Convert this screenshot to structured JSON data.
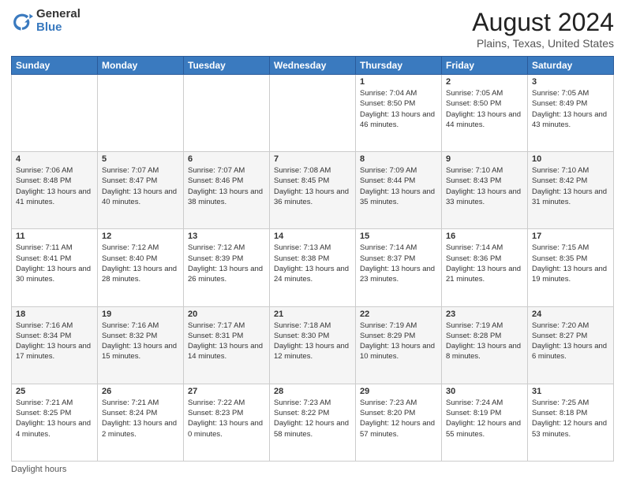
{
  "header": {
    "logo_general": "General",
    "logo_blue": "Blue",
    "title": "August 2024",
    "subtitle": "Plains, Texas, United States"
  },
  "days_of_week": [
    "Sunday",
    "Monday",
    "Tuesday",
    "Wednesday",
    "Thursday",
    "Friday",
    "Saturday"
  ],
  "weeks": [
    [
      {
        "day": "",
        "info": ""
      },
      {
        "day": "",
        "info": ""
      },
      {
        "day": "",
        "info": ""
      },
      {
        "day": "",
        "info": ""
      },
      {
        "day": "1",
        "info": "Sunrise: 7:04 AM\nSunset: 8:50 PM\nDaylight: 13 hours and 46 minutes."
      },
      {
        "day": "2",
        "info": "Sunrise: 7:05 AM\nSunset: 8:50 PM\nDaylight: 13 hours and 44 minutes."
      },
      {
        "day": "3",
        "info": "Sunrise: 7:05 AM\nSunset: 8:49 PM\nDaylight: 13 hours and 43 minutes."
      }
    ],
    [
      {
        "day": "4",
        "info": "Sunrise: 7:06 AM\nSunset: 8:48 PM\nDaylight: 13 hours and 41 minutes."
      },
      {
        "day": "5",
        "info": "Sunrise: 7:07 AM\nSunset: 8:47 PM\nDaylight: 13 hours and 40 minutes."
      },
      {
        "day": "6",
        "info": "Sunrise: 7:07 AM\nSunset: 8:46 PM\nDaylight: 13 hours and 38 minutes."
      },
      {
        "day": "7",
        "info": "Sunrise: 7:08 AM\nSunset: 8:45 PM\nDaylight: 13 hours and 36 minutes."
      },
      {
        "day": "8",
        "info": "Sunrise: 7:09 AM\nSunset: 8:44 PM\nDaylight: 13 hours and 35 minutes."
      },
      {
        "day": "9",
        "info": "Sunrise: 7:10 AM\nSunset: 8:43 PM\nDaylight: 13 hours and 33 minutes."
      },
      {
        "day": "10",
        "info": "Sunrise: 7:10 AM\nSunset: 8:42 PM\nDaylight: 13 hours and 31 minutes."
      }
    ],
    [
      {
        "day": "11",
        "info": "Sunrise: 7:11 AM\nSunset: 8:41 PM\nDaylight: 13 hours and 30 minutes."
      },
      {
        "day": "12",
        "info": "Sunrise: 7:12 AM\nSunset: 8:40 PM\nDaylight: 13 hours and 28 minutes."
      },
      {
        "day": "13",
        "info": "Sunrise: 7:12 AM\nSunset: 8:39 PM\nDaylight: 13 hours and 26 minutes."
      },
      {
        "day": "14",
        "info": "Sunrise: 7:13 AM\nSunset: 8:38 PM\nDaylight: 13 hours and 24 minutes."
      },
      {
        "day": "15",
        "info": "Sunrise: 7:14 AM\nSunset: 8:37 PM\nDaylight: 13 hours and 23 minutes."
      },
      {
        "day": "16",
        "info": "Sunrise: 7:14 AM\nSunset: 8:36 PM\nDaylight: 13 hours and 21 minutes."
      },
      {
        "day": "17",
        "info": "Sunrise: 7:15 AM\nSunset: 8:35 PM\nDaylight: 13 hours and 19 minutes."
      }
    ],
    [
      {
        "day": "18",
        "info": "Sunrise: 7:16 AM\nSunset: 8:34 PM\nDaylight: 13 hours and 17 minutes."
      },
      {
        "day": "19",
        "info": "Sunrise: 7:16 AM\nSunset: 8:32 PM\nDaylight: 13 hours and 15 minutes."
      },
      {
        "day": "20",
        "info": "Sunrise: 7:17 AM\nSunset: 8:31 PM\nDaylight: 13 hours and 14 minutes."
      },
      {
        "day": "21",
        "info": "Sunrise: 7:18 AM\nSunset: 8:30 PM\nDaylight: 13 hours and 12 minutes."
      },
      {
        "day": "22",
        "info": "Sunrise: 7:19 AM\nSunset: 8:29 PM\nDaylight: 13 hours and 10 minutes."
      },
      {
        "day": "23",
        "info": "Sunrise: 7:19 AM\nSunset: 8:28 PM\nDaylight: 13 hours and 8 minutes."
      },
      {
        "day": "24",
        "info": "Sunrise: 7:20 AM\nSunset: 8:27 PM\nDaylight: 13 hours and 6 minutes."
      }
    ],
    [
      {
        "day": "25",
        "info": "Sunrise: 7:21 AM\nSunset: 8:25 PM\nDaylight: 13 hours and 4 minutes."
      },
      {
        "day": "26",
        "info": "Sunrise: 7:21 AM\nSunset: 8:24 PM\nDaylight: 13 hours and 2 minutes."
      },
      {
        "day": "27",
        "info": "Sunrise: 7:22 AM\nSunset: 8:23 PM\nDaylight: 13 hours and 0 minutes."
      },
      {
        "day": "28",
        "info": "Sunrise: 7:23 AM\nSunset: 8:22 PM\nDaylight: 12 hours and 58 minutes."
      },
      {
        "day": "29",
        "info": "Sunrise: 7:23 AM\nSunset: 8:20 PM\nDaylight: 12 hours and 57 minutes."
      },
      {
        "day": "30",
        "info": "Sunrise: 7:24 AM\nSunset: 8:19 PM\nDaylight: 12 hours and 55 minutes."
      },
      {
        "day": "31",
        "info": "Sunrise: 7:25 AM\nSunset: 8:18 PM\nDaylight: 12 hours and 53 minutes."
      }
    ]
  ],
  "footer": {
    "note": "Daylight hours"
  }
}
